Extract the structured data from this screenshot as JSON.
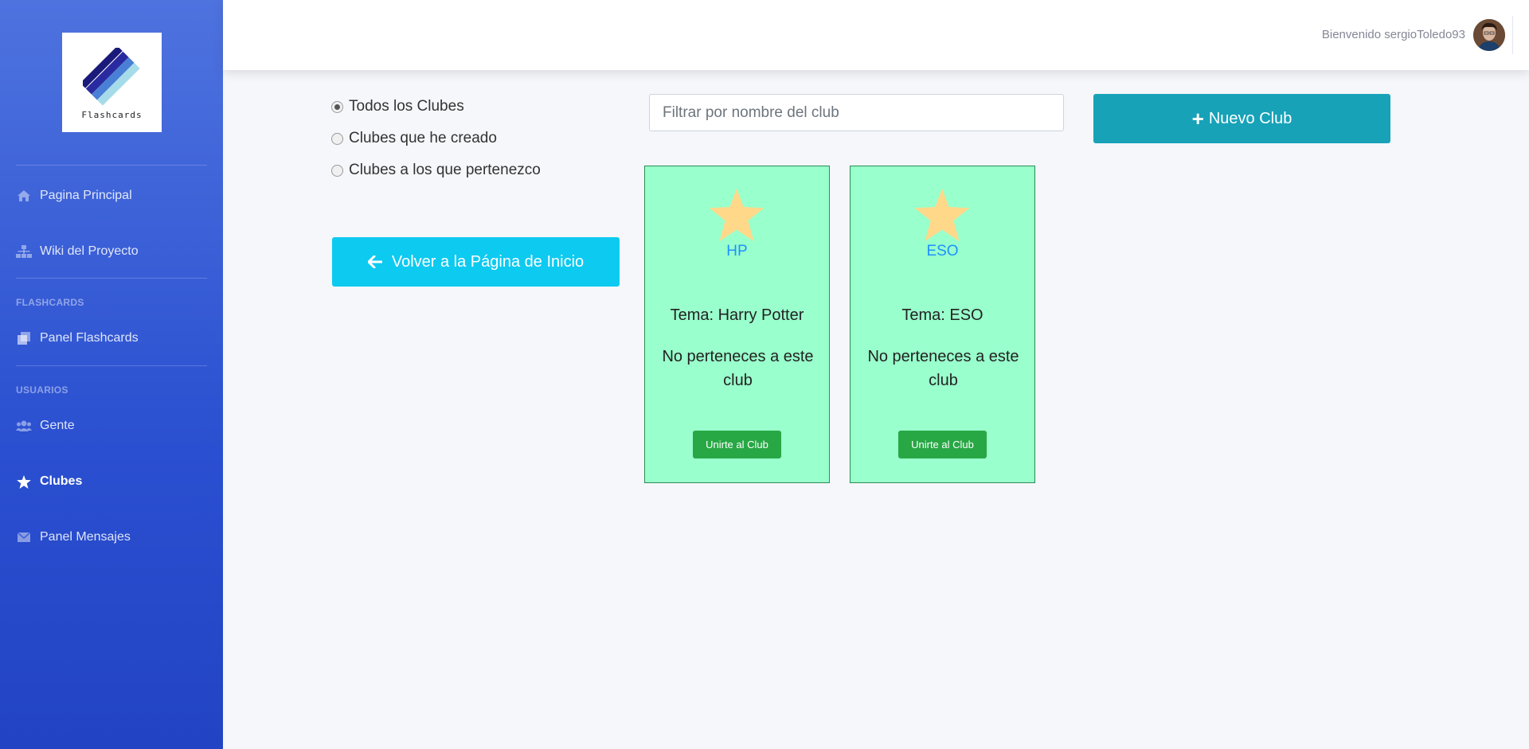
{
  "brand": {
    "name": "Flashcards"
  },
  "sidebar": {
    "items": [
      {
        "label": "Pagina Principal",
        "icon": "home-icon"
      },
      {
        "label": "Wiki del Proyecto",
        "icon": "sitemap-icon"
      },
      {
        "label": "Panel Flashcards",
        "icon": "copy-icon"
      },
      {
        "label": "Gente",
        "icon": "users-icon"
      },
      {
        "label": "Clubes",
        "icon": "star-icon",
        "active": true
      },
      {
        "label": "Panel Mensajes",
        "icon": "envelope-icon"
      }
    ],
    "headings": {
      "flashcards": "FLASHCARDS",
      "usuarios": "USUARIOS"
    }
  },
  "topbar": {
    "welcome": "Bienvenido sergioToledo93"
  },
  "filters": {
    "options": [
      {
        "label": "Todos los Clubes",
        "checked": true
      },
      {
        "label": "Clubes que he creado",
        "checked": false
      },
      {
        "label": "Clubes a los que pertenezco",
        "checked": false
      }
    ],
    "search_placeholder": "Filtrar por nombre del club",
    "new_club_label": "Nuevo Club",
    "back_label": "Volver a la Página de Inicio"
  },
  "clubs": [
    {
      "name": "HP",
      "tema": "Tema: Harry Potter",
      "status": "No perteneces a este club",
      "join_label": "Unirte al Club"
    },
    {
      "name": "ESO",
      "tema": "Tema: ESO",
      "status": "No perteneces a este club",
      "join_label": "Unirte al Club"
    }
  ],
  "colors": {
    "sidebar": "#4e73df",
    "card_bg": "#99ffcc",
    "new_club": "#17a2b8",
    "back": "#0dcaf0",
    "join": "#28a745",
    "club_name": "#1e90ff",
    "star": "#ffd88a"
  }
}
